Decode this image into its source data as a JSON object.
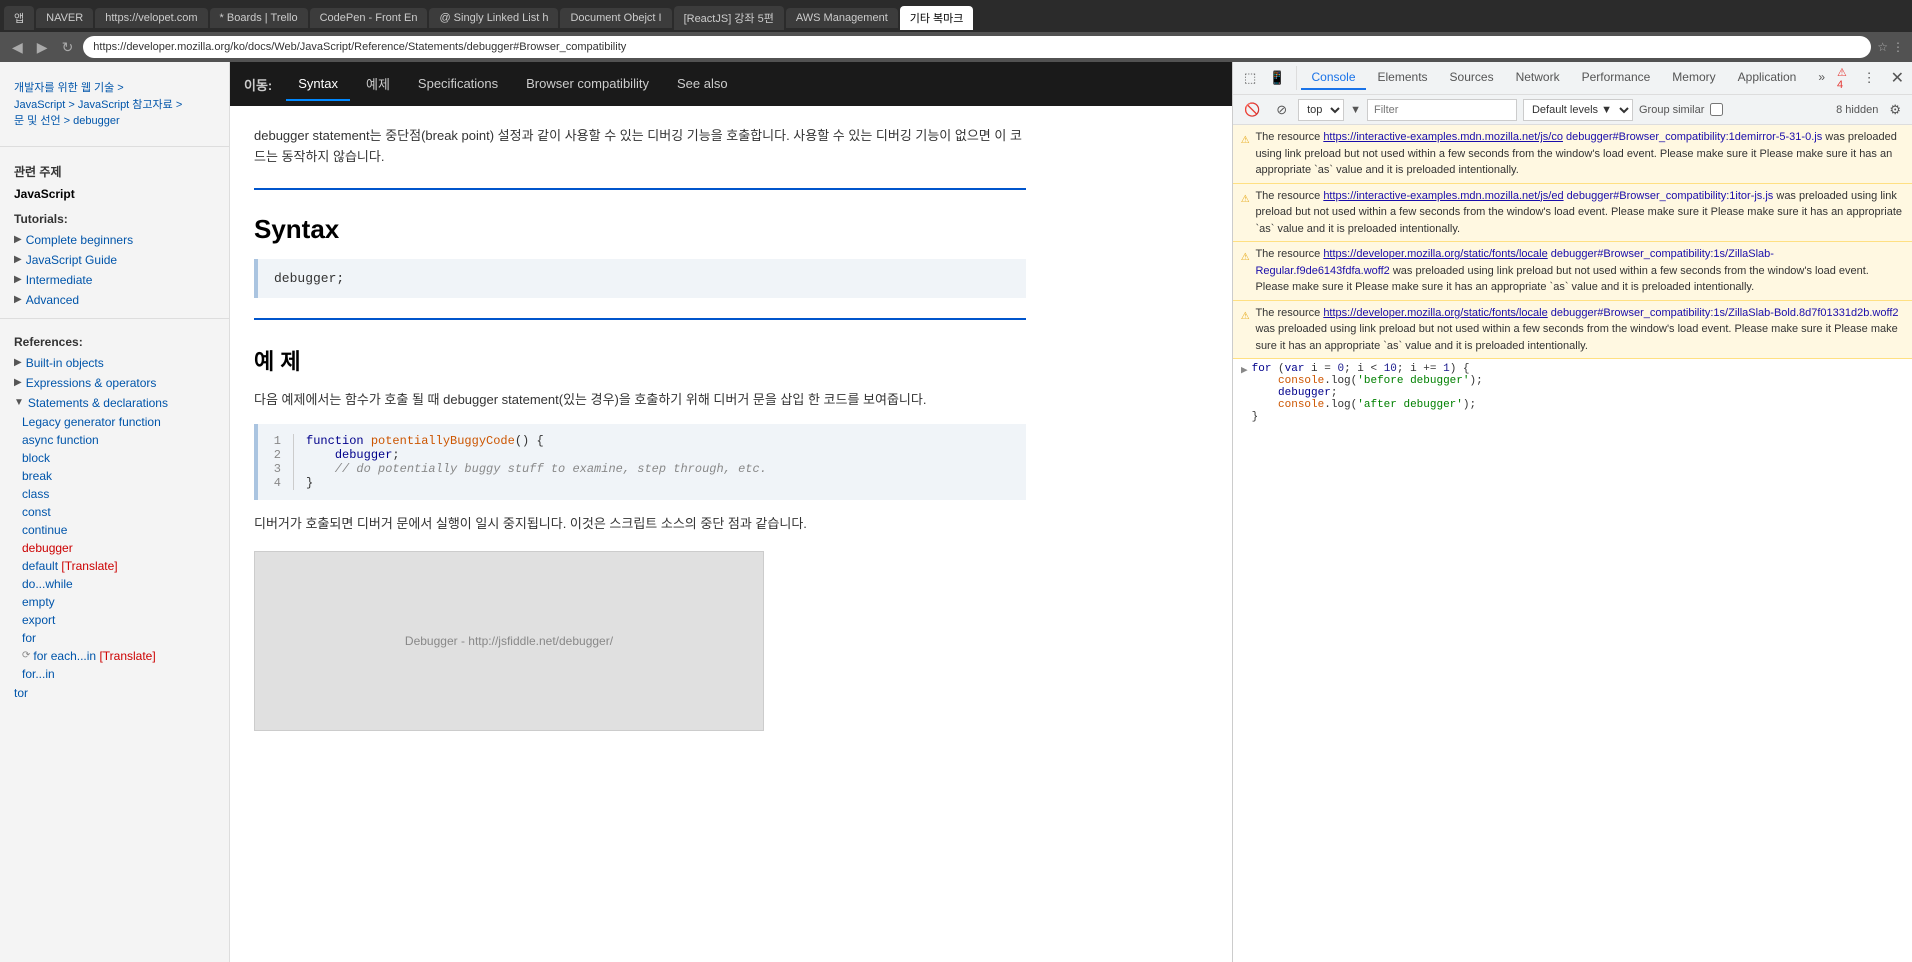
{
  "browser": {
    "address": "https://developer.mozilla.org/ko/docs/Web/JavaScript/Reference/Statements/debugger#Browser_compatibility",
    "tabs": [
      {
        "label": "앱",
        "active": false
      },
      {
        "label": "NAVER",
        "active": false
      },
      {
        "label": "https://velopet.com",
        "active": false
      },
      {
        "label": "* Boards | Trello",
        "active": false
      },
      {
        "label": "CodePen - Front En",
        "active": false
      },
      {
        "label": "@ Singly Linked List h",
        "active": false
      },
      {
        "label": "Document Obejct I",
        "active": false
      },
      {
        "label": "[ReactJS] 강좌 5편",
        "active": false
      },
      {
        "label": "AWS Management",
        "active": false
      },
      {
        "label": "기타 복마크",
        "active": false
      }
    ]
  },
  "top_nav": {
    "label": "이동:",
    "tabs": [
      {
        "label": "Syntax",
        "active": true
      },
      {
        "label": "예제",
        "active": false
      },
      {
        "label": "Specifications",
        "active": false
      },
      {
        "label": "Browser compatibility",
        "active": false
      },
      {
        "label": "See also",
        "active": false
      }
    ]
  },
  "sidebar": {
    "breadcrumb_lines": [
      "개발자를 위한 웹 기술 >",
      "JavaScript > JavaScript 참고자료 >",
      "문 및 선언 > debugger"
    ],
    "related_title": "관련 주제",
    "javascript_label": "JavaScript",
    "tutorials_label": "Tutorials:",
    "tutorial_items": [
      {
        "label": "Complete beginners",
        "expanded": false
      },
      {
        "label": "JavaScript Guide",
        "expanded": false
      },
      {
        "label": "Intermediate",
        "expanded": false
      },
      {
        "label": "Advanced",
        "expanded": false
      }
    ],
    "references_label": "References:",
    "reference_items": [
      {
        "label": "Built-in objects",
        "expanded": false
      },
      {
        "label": "Expressions & operators",
        "expanded": false
      },
      {
        "label": "Statements & declarations",
        "expanded": true
      }
    ],
    "statements_items": [
      {
        "label": "Legacy generator function",
        "active": false
      },
      {
        "label": "async function",
        "active": false
      },
      {
        "label": "block",
        "active": false
      },
      {
        "label": "break",
        "active": false
      },
      {
        "label": "class",
        "active": false
      },
      {
        "label": "const",
        "active": false
      },
      {
        "label": "continue",
        "active": false
      },
      {
        "label": "debugger",
        "active": true
      },
      {
        "label": "default",
        "active": false,
        "translate": "[Translate]"
      },
      {
        "label": "do...while",
        "active": false
      },
      {
        "label": "empty",
        "active": false
      },
      {
        "label": "export",
        "active": false
      },
      {
        "label": "for",
        "active": false
      },
      {
        "label": "for each...in",
        "active": false,
        "translate": "[Translate]"
      },
      {
        "label": "for...in",
        "active": false
      }
    ],
    "bottom_item": "tor"
  },
  "content": {
    "intro_text": "debugger statement는 중단점(break point) 설정과 같이 사용할 수 있는 디버깅 기능을 호출합니다. 사용할 수 있는 디버깅 기능이 없으면 이 코드는 동작하지 않습니다.",
    "syntax_heading": "Syntax",
    "syntax_code": "debugger;",
    "example_heading": "예 제",
    "example_intro": "다음 예제에서는 함수가 호출 될 때 debugger statement(있는 경우)을 호출하기 위해 디버거 문을 삽입 한 코드를 보여줍니다.",
    "code_lines": [
      {
        "num": "1",
        "tokens": [
          {
            "type": "kw",
            "text": "function"
          },
          {
            "type": "space",
            "text": " "
          },
          {
            "type": "fn",
            "text": "potentiallyBuggyCode"
          },
          {
            "type": "punct",
            "text": "() {"
          }
        ]
      },
      {
        "num": "2",
        "tokens": [
          {
            "type": "kw",
            "text": "    debugger"
          },
          {
            "type": "punct",
            "text": ";"
          }
        ]
      },
      {
        "num": "3",
        "tokens": [
          {
            "type": "comment",
            "text": "    // do potentially buggy stuff to examine, step through, etc."
          }
        ]
      },
      {
        "num": "4",
        "tokens": [
          {
            "type": "punct",
            "text": "}"
          }
        ]
      }
    ],
    "after_code_text": "디버거가 호출되면 디버거 문에서 실행이 일시 중지됩니다. 이것은 스크립트 소스의 중단 점과 같습니다.",
    "screenshot_label": "Debugger - http://jsfiddle.net/debugger/"
  },
  "devtools": {
    "tabs": [
      "Console",
      "Elements",
      "Sources",
      "Network",
      "Performance",
      "Memory",
      "Application"
    ],
    "active_tab": "Console",
    "more_label": "»",
    "filter_select_value": "top",
    "filter_placeholder": "Filter",
    "default_levels_label": "Default levels ▼",
    "group_similar_label": "Group similar",
    "hidden_count": "8 hidden",
    "warnings": [
      {
        "text_before": "The resource ",
        "link": "https://interactive-examples.mdn.mozilla.net/js/co",
        "link_after": "debugger#Browser_compatibility:1demirror-5-31-0.js",
        "text_after": " was preloaded using link preload but not used within a few seconds from the window's load event. Please make sure it Please make sure it has an appropriate `as` value and it is preloaded intentionally."
      },
      {
        "text_before": "The resource ",
        "link": "https://interactive-examples.mdn.mozilla.net/js/ed",
        "link_after": "debugger#Browser_compatibility:1itor-js.js",
        "text_after": " was preloaded using link preload but not used within a few seconds from the window's load event. Please make sure it Please make sure it has an appropriate `as` value and it is preloaded intentionally."
      },
      {
        "text_before": "The resource ",
        "link": "https://developer.mozilla.org/static/fonts/locale",
        "link_after": "debugger#Browser_compatibility:1s/ZillaSlab-Regular.f9de6143fdfa.woff2",
        "text_after": " was preloaded using link preload but not used within a few seconds from the window's load event. Please make sure it Please make sure it has an appropriate `as` value and it is preloaded intentionally."
      },
      {
        "text_before": "The resource ",
        "link": "https://developer.mozilla.org/static/fonts/locale",
        "link_after": "debugger#Browser_compatibility:1s/ZillaSlab-Bold.8d7f01331d2b.woff2",
        "text_after": " was preloaded using link preload but not used within a few seconds from the window's load event. Please make sure it Please make sure it has an appropriate `as` value and it is preloaded intentionally."
      }
    ],
    "console_code": {
      "arrow": "▶",
      "line1": "for (var i = 0; i < 10; i += 1) {",
      "line2": "    console.log('before debugger');",
      "line3": "    debugger;",
      "line4": "    console.log('after debugger');",
      "line5": "}"
    },
    "badge_count": "4",
    "settings_icon": "⚙"
  }
}
